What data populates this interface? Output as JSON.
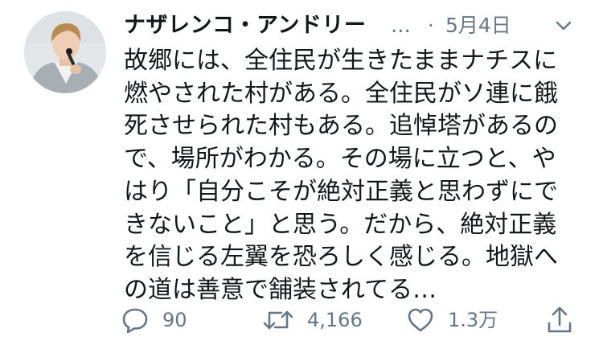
{
  "tweet": {
    "author_name": "ナザレンコ・アンドリー",
    "truncation": "...",
    "separator": "·",
    "date": "5月4日",
    "text_lines": [
      "故郷には、全住民が生きたままナチスに",
      "燃やされた村がある。全住民がソ連に餓",
      "死させられた村もある。追悼塔があるの",
      "で、場所がわかる。その場に立つと、や",
      "はり「自分こそが絶対正義と思わずにで",
      "きないこと」と思う。だから、絶対正義",
      "を信じる左翼を恐ろしく感じる。地獄へ",
      "の道は善意で舗装されてる…"
    ]
  },
  "actions": {
    "reply_count": "90",
    "retweet_count": "4,166",
    "like_count": "1.3万"
  },
  "icons": {
    "reply": "reply-icon",
    "retweet": "retweet-icon",
    "like": "heart-icon",
    "share": "share-icon",
    "caret": "chevron-down-icon"
  },
  "colors": {
    "text": "#14171a",
    "secondary": "#657786"
  }
}
